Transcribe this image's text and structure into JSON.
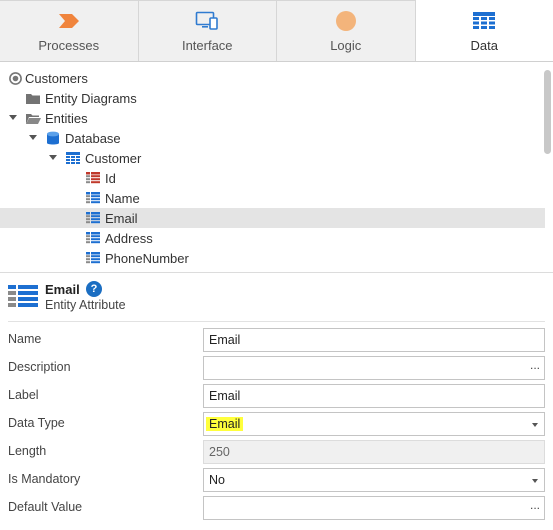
{
  "tabs": [
    {
      "label": "Processes",
      "icon": "processes-chevron-icon",
      "color": "#f0843c"
    },
    {
      "label": "Interface",
      "icon": "monitor-device-icon",
      "color": "#2f7bd0"
    },
    {
      "label": "Logic",
      "icon": "logic-circle-icon",
      "color": "#f3b47b"
    },
    {
      "label": "Data",
      "icon": "data-table-icon",
      "color": "#1d6fd1"
    }
  ],
  "active_tab": "Data",
  "tree": {
    "items": [
      {
        "label": "Customers",
        "icon": "module-icon"
      },
      {
        "label": "Entity Diagrams",
        "icon": "folder-icon"
      },
      {
        "label": "Entities",
        "icon": "folder-open-icon"
      },
      {
        "label": "Database",
        "icon": "database-icon"
      },
      {
        "label": "Customer",
        "icon": "entity-icon"
      },
      {
        "label": "Id",
        "icon": "identifier-attribute-icon"
      },
      {
        "label": "Name",
        "icon": "attribute-icon"
      },
      {
        "label": "Email",
        "icon": "attribute-icon"
      },
      {
        "label": "Address",
        "icon": "attribute-icon"
      },
      {
        "label": "PhoneNumber",
        "icon": "attribute-icon"
      }
    ],
    "selected": "Email"
  },
  "properties": {
    "title": "Email",
    "help": "?",
    "subtitle": "Entity Attribute",
    "rows": [
      {
        "label": "Name",
        "value": "Email"
      },
      {
        "label": "Description",
        "value": "",
        "button": "..."
      },
      {
        "label": "Label",
        "value": "Email"
      },
      {
        "label": "Data Type",
        "value": "Email"
      },
      {
        "label": "Length",
        "value": "250"
      },
      {
        "label": "Is Mandatory",
        "value": "No"
      },
      {
        "label": "Default Value",
        "value": "",
        "button": "..."
      }
    ]
  },
  "colors": {
    "highlight": "#ffff3c",
    "accent": "#1b6ec2"
  }
}
